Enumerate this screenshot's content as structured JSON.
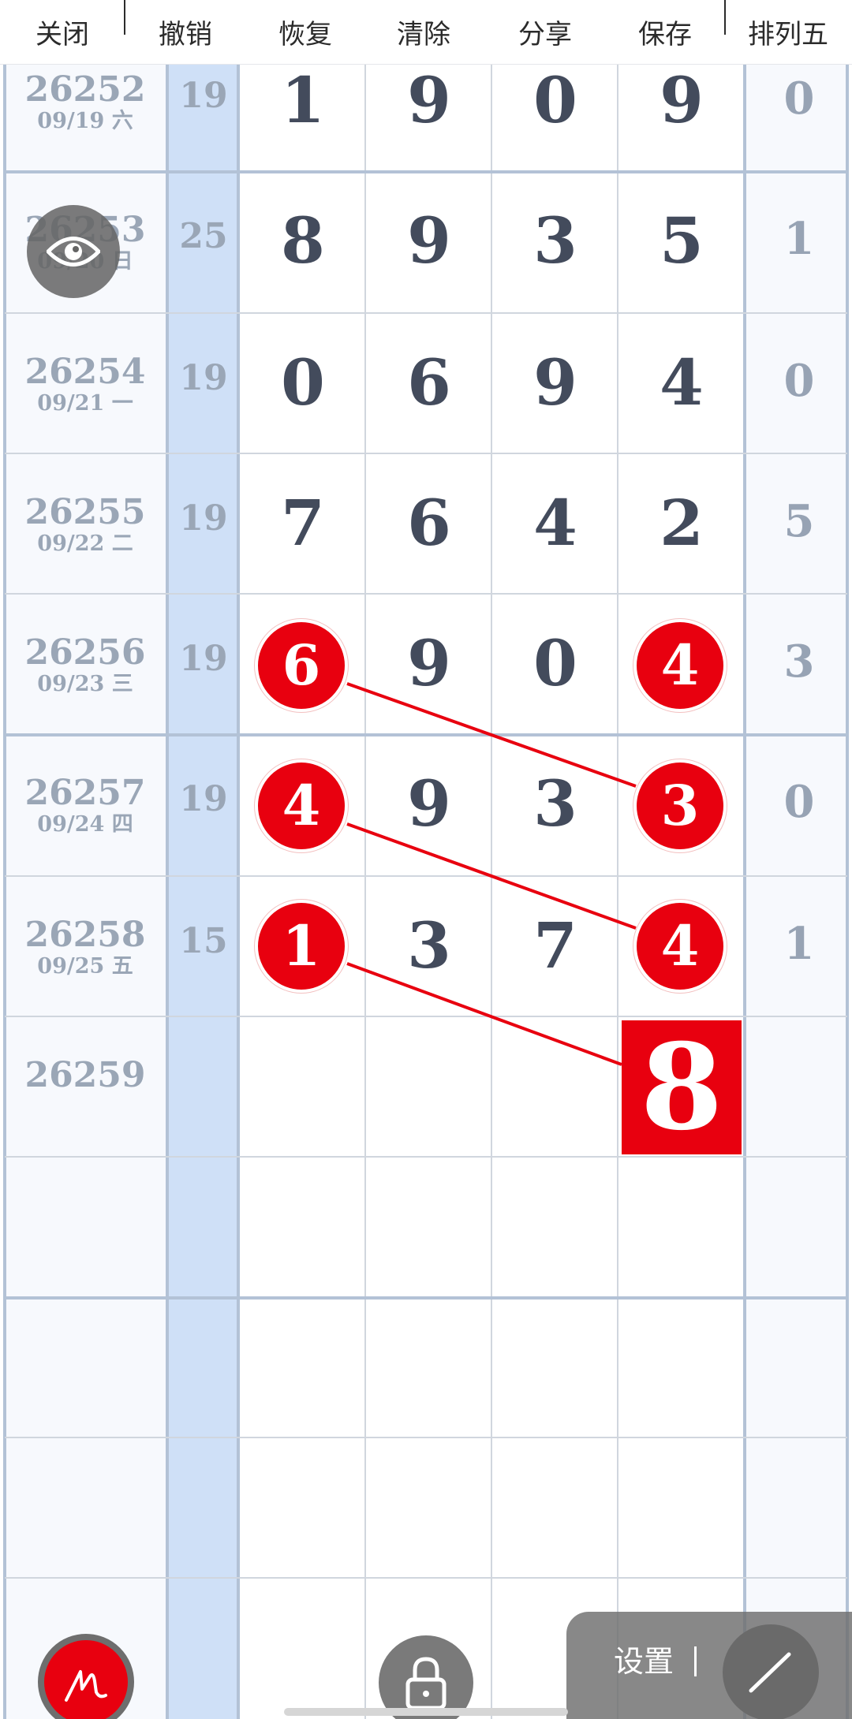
{
  "toolbar": {
    "close_label": "关闭",
    "undo_label": "撤销",
    "redo_label": "恢复",
    "clear_label": "清除",
    "share_label": "分享",
    "save_label": "保存",
    "game_label": "排列五"
  },
  "rows": [
    {
      "issue": "26252",
      "date": "09/19 六",
      "sum": "19",
      "digits": [
        "1",
        "9",
        "0",
        "9"
      ],
      "span": "0"
    },
    {
      "issue": "26253",
      "date": "09/20 日",
      "sum": "25",
      "digits": [
        "8",
        "9",
        "3",
        "5"
      ],
      "span": "1"
    },
    {
      "issue": "26254",
      "date": "09/21 一",
      "sum": "19",
      "digits": [
        "0",
        "6",
        "9",
        "4"
      ],
      "span": "0"
    },
    {
      "issue": "26255",
      "date": "09/22 二",
      "sum": "19",
      "digits": [
        "7",
        "6",
        "4",
        "2"
      ],
      "span": "5"
    },
    {
      "issue": "26256",
      "date": "09/23 三",
      "sum": "19",
      "digits": [
        "6",
        "9",
        "0",
        "4"
      ],
      "span": "3"
    },
    {
      "issue": "26257",
      "date": "09/24 四",
      "sum": "19",
      "digits": [
        "4",
        "9",
        "3",
        "3"
      ],
      "span": "0"
    },
    {
      "issue": "26258",
      "date": "09/25 五",
      "sum": "15",
      "digits": [
        "1",
        "3",
        "7",
        "4"
      ],
      "span": "1"
    },
    {
      "issue": "26259",
      "date": "",
      "sum": "",
      "digits": [
        "",
        "",
        "",
        ""
      ],
      "span": ""
    }
  ],
  "prediction": {
    "digit": "8"
  },
  "settings": {
    "label": "设置"
  },
  "colors": {
    "accent_red": "#e8000f",
    "sum_column_bg": "#cfe0f7",
    "grid_line": "#b3c2d6",
    "digit_text": "#434b5c",
    "muted_text": "#9aa6b6"
  },
  "icons": {
    "eye": "eye-icon",
    "signature": "signature-icon",
    "lock": "lock-icon",
    "pen": "pen-icon"
  }
}
